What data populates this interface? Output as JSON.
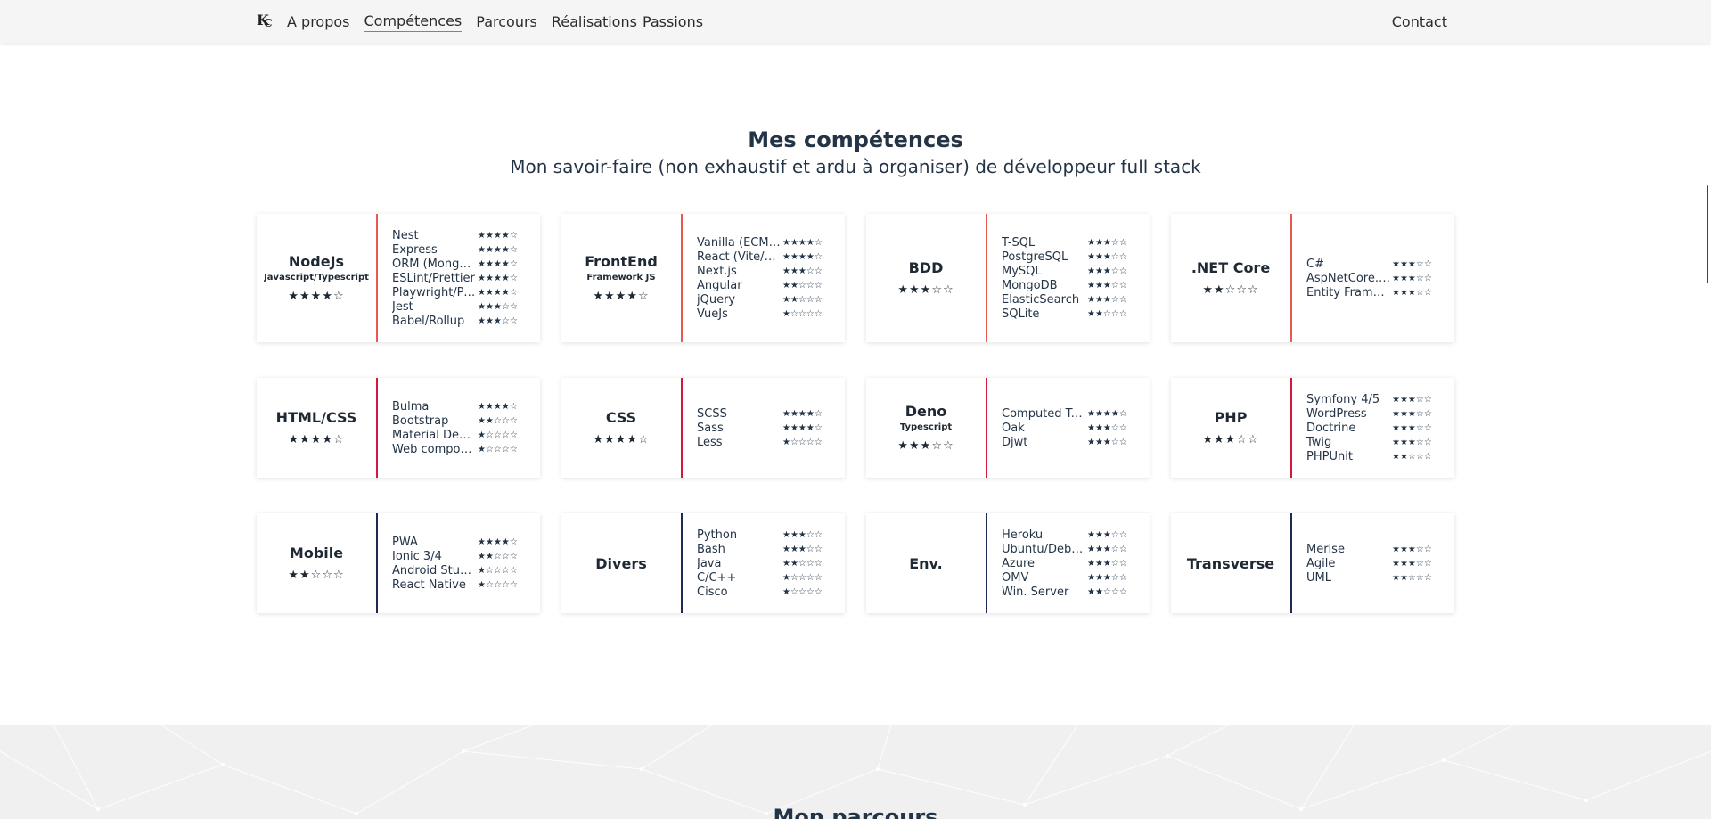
{
  "nav": {
    "links": [
      "A propos",
      "Compétences",
      "Parcours",
      "Réalisations",
      "Passions"
    ],
    "contact": "Contact"
  },
  "section": {
    "title": "Mes compétences",
    "subtitle": "Mon savoir-faire (non exhaustif et ardu à organiser) de développeur full stack"
  },
  "colors": {
    "accent_red": "#e85a4f",
    "accent_crimson": "#d3173d",
    "accent_navy": "#1d2b52"
  },
  "cards": [
    {
      "name": "NodeJs",
      "tag": "Javascript/Typescript",
      "stars": "★★★★☆",
      "accent": "#e85a4f",
      "items": [
        {
          "name": "Nest",
          "stars": "★★★★☆"
        },
        {
          "name": "Express",
          "stars": "★★★★☆"
        },
        {
          "name": "ORM (Mongoose)",
          "stars": "★★★★☆"
        },
        {
          "name": "ESLint/Prettier",
          "stars": "★★★★☆"
        },
        {
          "name": "Playwright/Puppeteer",
          "stars": "★★★★☆"
        },
        {
          "name": "Jest",
          "stars": "★★★☆☆"
        },
        {
          "name": "Babel/Rollup",
          "stars": "★★★☆☆"
        }
      ]
    },
    {
      "name": "FrontEnd",
      "tag": "Framework JS",
      "stars": "★★★★☆",
      "accent": "#e85a4f",
      "items": [
        {
          "name": "Vanilla (ECMAScript)",
          "stars": "★★★★☆"
        },
        {
          "name": "React (Vite/Redux)",
          "stars": "★★★★☆"
        },
        {
          "name": "Next.js",
          "stars": "★★★☆☆"
        },
        {
          "name": "Angular",
          "stars": "★★☆☆☆"
        },
        {
          "name": "jQuery",
          "stars": "★★☆☆☆"
        },
        {
          "name": "VueJs",
          "stars": "★☆☆☆☆"
        }
      ]
    },
    {
      "name": "BDD",
      "tag": "",
      "stars": "★★★☆☆",
      "accent": "#e85a4f",
      "items": [
        {
          "name": "T-SQL",
          "stars": "★★★☆☆"
        },
        {
          "name": "PostgreSQL",
          "stars": "★★★☆☆"
        },
        {
          "name": "MySQL",
          "stars": "★★★☆☆"
        },
        {
          "name": "MongoDB",
          "stars": "★★★☆☆"
        },
        {
          "name": "ElasticSearch",
          "stars": "★★★☆☆"
        },
        {
          "name": "SQLite",
          "stars": "★★☆☆☆"
        }
      ]
    },
    {
      "name": ".NET Core",
      "tag": "",
      "stars": "★★☆☆☆",
      "accent": "#e85a4f",
      "items": [
        {
          "name": "C#",
          "stars": "★★★☆☆"
        },
        {
          "name": "AspNetCore.MVC",
          "stars": "★★★☆☆"
        },
        {
          "name": "Entity Framework",
          "stars": "★★★☆☆"
        }
      ]
    },
    {
      "name": "HTML/CSS",
      "tag": "",
      "stars": "★★★★☆",
      "accent": "#d3173d",
      "items": [
        {
          "name": "Bulma",
          "stars": "★★★★☆"
        },
        {
          "name": "Bootstrap",
          "stars": "★★☆☆☆"
        },
        {
          "name": "Material Design",
          "stars": "★☆☆☆☆"
        },
        {
          "name": "Web components",
          "stars": "★☆☆☆☆"
        }
      ]
    },
    {
      "name": "CSS",
      "tag": "",
      "stars": "★★★★☆",
      "accent": "#d3173d",
      "items": [
        {
          "name": "SCSS",
          "stars": "★★★★☆"
        },
        {
          "name": "Sass",
          "stars": "★★★★☆"
        },
        {
          "name": "Less",
          "stars": "★☆☆☆☆"
        }
      ]
    },
    {
      "name": "Deno",
      "tag": "Typescript",
      "stars": "★★★☆☆",
      "accent": "#d3173d",
      "items": [
        {
          "name": "Computed Types",
          "stars": "★★★★☆"
        },
        {
          "name": "Oak",
          "stars": "★★★☆☆"
        },
        {
          "name": "Djwt",
          "stars": "★★★☆☆"
        }
      ]
    },
    {
      "name": "PHP",
      "tag": "",
      "stars": "★★★☆☆",
      "accent": "#d3173d",
      "items": [
        {
          "name": "Symfony 4/5",
          "stars": "★★★☆☆"
        },
        {
          "name": "WordPress",
          "stars": "★★★☆☆"
        },
        {
          "name": "Doctrine",
          "stars": "★★★☆☆"
        },
        {
          "name": "Twig",
          "stars": "★★★☆☆"
        },
        {
          "name": "PHPUnit",
          "stars": "★★☆☆☆"
        }
      ]
    },
    {
      "name": "Mobile",
      "tag": "",
      "stars": "★★☆☆☆",
      "accent": "#1d2b52",
      "items": [
        {
          "name": "PWA",
          "stars": "★★★★☆"
        },
        {
          "name": "Ionic 3/4",
          "stars": "★★☆☆☆"
        },
        {
          "name": "Android Studio",
          "stars": "★☆☆☆☆"
        },
        {
          "name": "React Native",
          "stars": "★☆☆☆☆"
        }
      ]
    },
    {
      "name": "Divers",
      "tag": "",
      "stars": "",
      "accent": "#1d2b52",
      "items": [
        {
          "name": "Python",
          "stars": "★★★☆☆"
        },
        {
          "name": "Bash",
          "stars": "★★★☆☆"
        },
        {
          "name": "Java",
          "stars": "★★☆☆☆"
        },
        {
          "name": "C/C++",
          "stars": "★☆☆☆☆"
        },
        {
          "name": "Cisco",
          "stars": "★☆☆☆☆"
        }
      ]
    },
    {
      "name": "Env.",
      "tag": "",
      "stars": "",
      "accent": "#1d2b52",
      "items": [
        {
          "name": "Heroku",
          "stars": "★★★☆☆"
        },
        {
          "name": "Ubuntu/Debian",
          "stars": "★★★☆☆"
        },
        {
          "name": "Azure",
          "stars": "★★★☆☆"
        },
        {
          "name": "OMV",
          "stars": "★★★☆☆"
        },
        {
          "name": "Win. Server",
          "stars": "★★☆☆☆"
        }
      ]
    },
    {
      "name": "Transverse",
      "tag": "",
      "stars": "",
      "accent": "#1d2b52",
      "items": [
        {
          "name": "Merise",
          "stars": "★★★☆☆"
        },
        {
          "name": "Agile",
          "stars": "★★★☆☆"
        },
        {
          "name": "UML",
          "stars": "★★☆☆☆"
        }
      ]
    }
  ],
  "next_section": {
    "title": "Mon parcours"
  }
}
